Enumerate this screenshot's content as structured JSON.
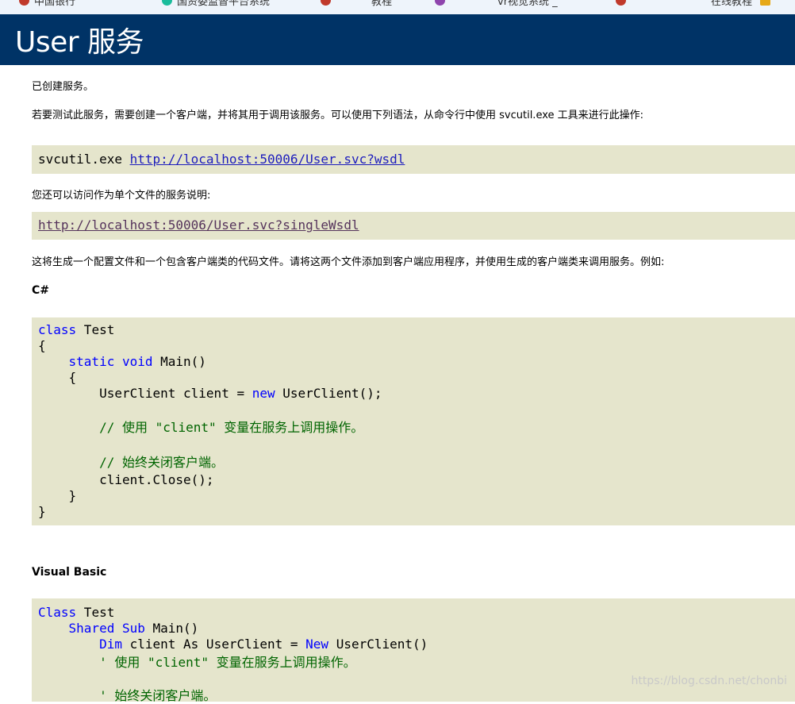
{
  "bookmarks": [
    {
      "label": "中国银行",
      "color": "#c0392b"
    },
    {
      "label": "国资委监督平台系统",
      "color": "#1abc9c"
    },
    {
      "label": "",
      "color": "#c0392b"
    },
    {
      "label": "教程",
      "color": "#8e44ad"
    },
    {
      "label": "vr视觉系统 _",
      "color": "#8e44ad"
    },
    {
      "label": "",
      "color": "#c0392b"
    },
    {
      "label": "在线教程",
      "color": "#e6a817"
    }
  ],
  "header": {
    "title": "User 服务"
  },
  "intro": {
    "created": "已创建服务。",
    "instruction": "若要测试此服务，需要创建一个客户端，并将其用于调用该服务。可以使用下列语法，从命令行中使用 svcutil.exe 工具来进行此操作:"
  },
  "svcutil": {
    "command": "svcutil.exe ",
    "wsdl_link": "http://localhost:50006/User.svc?wsdl"
  },
  "single_file": {
    "text": "您还可以访问作为单个文件的服务说明:",
    "link": "http://localhost:50006/User.svc?singleWsdl"
  },
  "generate_text": "这将生成一个配置文件和一个包含客户端类的代码文件。请将这两个文件添加到客户端应用程序，并使用生成的客户端类来调用服务。例如:",
  "csharp": {
    "heading": "C#",
    "lines": {
      "l1_kw": "class",
      "l1_rest": " Test",
      "l2": "{",
      "l3_kw1": "static",
      "l3_kw2": "void",
      "l3_rest": " Main()",
      "l4": "{",
      "l5_a": "UserClient client = ",
      "l5_kw": "new",
      "l5_b": " UserClient();",
      "l6_comment": "// 使用 \"client\" 变量在服务上调用操作。",
      "l7_comment": "// 始终关闭客户端。",
      "l8": "client.Close();",
      "l9": "}",
      "l10": "}"
    }
  },
  "vb": {
    "heading": "Visual Basic",
    "lines": {
      "l1_kw": "Class",
      "l1_rest": " Test",
      "l2_kw1": "Shared",
      "l2_kw2": "Sub",
      "l2_rest": " Main()",
      "l3_kw1": "Dim",
      "l3_mid": " client As UserClient = ",
      "l3_kw2": "New",
      "l3_rest": " UserClient()",
      "l4_comment": "' 使用 \"client\" 变量在服务上调用操作。",
      "l5_comment": "' 始终关闭客户端。"
    }
  },
  "watermark": "https://blog.csdn.net/chonbi"
}
